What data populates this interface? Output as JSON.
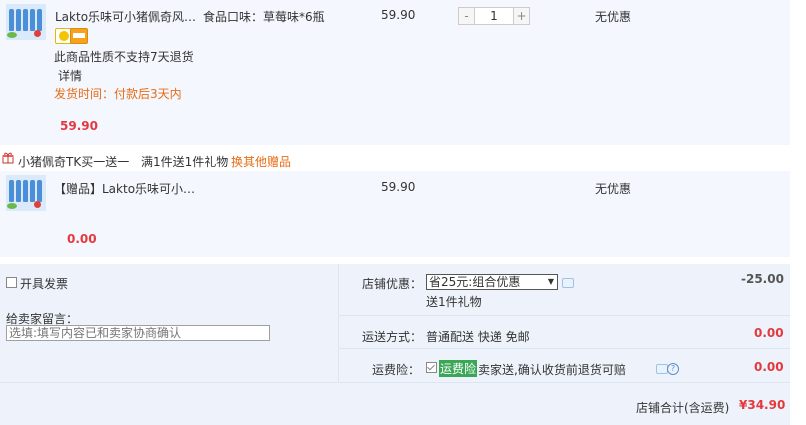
{
  "item": {
    "name": "Lakto乐味可小猪佩奇风…",
    "sku": "食品口味：草莓味*6瓶",
    "price": "59.90",
    "quantity": "1",
    "qty_minus": "-",
    "qty_plus": "+",
    "discount": "无优惠",
    "no_return": "此商品性质不支持7天退货",
    "detail_link": "详情",
    "ship_time": "发货时间：付款后3天内",
    "subtotal": "59.90"
  },
  "promo": {
    "name": "小猪佩奇TK买一送一",
    "rule": "满1件送1件礼物",
    "change_link": "换其他赠品"
  },
  "gift": {
    "name": "【赠品】Lakto乐味可小…",
    "price": "59.90",
    "discount": "无优惠",
    "subtotal": "0.00"
  },
  "invoice": {
    "label": "开具发票",
    "checked": false
  },
  "message": {
    "label": "给卖家留言：",
    "placeholder": "选填:填写内容已和卖家协商确认"
  },
  "shop_discount": {
    "label": "店铺优惠：",
    "selected": "省25元:组合优惠",
    "note": "送1件礼物",
    "amount": "-25.00"
  },
  "shipping": {
    "label": "运送方式：",
    "value": "普通配送 快递 免邮",
    "amount": "0.00"
  },
  "insurance": {
    "label": "运费险：",
    "checked": true,
    "tag": "运费险",
    "desc": "卖家送,确认收货前退货可赔",
    "amount": "0.00"
  },
  "total": {
    "label": "店铺合计(含运费)",
    "amount": "¥34.90"
  },
  "colors": {
    "price_red": "#e4393c",
    "orange": "#e86c15",
    "bg": "#f4f7fd"
  }
}
